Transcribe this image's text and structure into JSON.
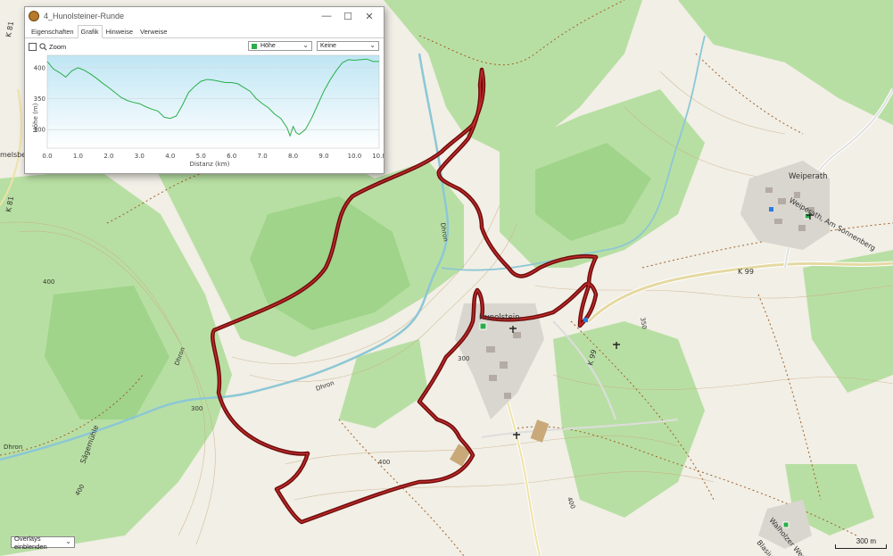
{
  "window": {
    "title": "4_Hunolsteiner-Runde",
    "minimize_glyph": "—",
    "maximize_glyph": "☐",
    "close_glyph": "✕",
    "tabs": [
      {
        "label": "Eigenschaften",
        "active": false
      },
      {
        "label": "Grafik",
        "active": true
      },
      {
        "label": "Hinweise",
        "active": false
      },
      {
        "label": "Verweise",
        "active": false
      }
    ],
    "zoom_label": "Zoom",
    "series_select": "Höhe",
    "series_color": "#2bae4a",
    "second_select": "Keine",
    "arrow": "⌄"
  },
  "chart_data": {
    "type": "area",
    "ylabel": "Höhe (m)",
    "xlabel": "Distanz  (km)",
    "xlim": [
      0,
      10.8
    ],
    "ylim": [
      270,
      420
    ],
    "xticks": [
      "0.0",
      "1.0",
      "2.0",
      "3.0",
      "4.0",
      "5.0",
      "6.0",
      "7.0",
      "8.0",
      "9.0",
      "10.0",
      "10.8"
    ],
    "yticks": [
      "400",
      "350",
      "300"
    ],
    "x": [
      0,
      0.2,
      0.4,
      0.6,
      0.8,
      1.0,
      1.2,
      1.4,
      1.6,
      1.8,
      2.0,
      2.2,
      2.4,
      2.6,
      2.8,
      3.0,
      3.2,
      3.4,
      3.6,
      3.8,
      4.0,
      4.2,
      4.4,
      4.6,
      4.8,
      5.0,
      5.2,
      5.4,
      5.6,
      5.8,
      6.0,
      6.2,
      6.4,
      6.6,
      6.8,
      7.0,
      7.2,
      7.4,
      7.6,
      7.8,
      7.9,
      8.0,
      8.1,
      8.2,
      8.4,
      8.6,
      8.8,
      9.0,
      9.2,
      9.4,
      9.6,
      9.8,
      10.0,
      10.2,
      10.4,
      10.6,
      10.8
    ],
    "y": [
      410,
      398,
      392,
      385,
      395,
      400,
      396,
      390,
      383,
      375,
      368,
      360,
      352,
      347,
      344,
      342,
      337,
      333,
      330,
      320,
      318,
      322,
      340,
      360,
      370,
      378,
      381,
      380,
      378,
      376,
      376,
      374,
      368,
      362,
      350,
      342,
      335,
      325,
      318,
      303,
      290,
      305,
      295,
      292,
      300,
      318,
      340,
      362,
      380,
      395,
      408,
      413,
      412,
      413,
      414,
      410,
      410
    ]
  },
  "map": {
    "labels": {
      "village1": "Hunolstein",
      "village2": "Weiperath",
      "street1": "Weiperath, Am Sonnenberg",
      "street2": "Walholzer Weg",
      "street3": "Blasius",
      "mill": "Sägemühle",
      "road1": "K 99",
      "road2": "K 99",
      "road3": "K 81",
      "road4": "K 81",
      "river1": "Dhron",
      "river2": "Dhron",
      "river3": "Dhron",
      "river4": "Dhron",
      "place_partial": "melsberg",
      "contour1": "400",
      "contour2": "300",
      "contour3": "300",
      "contour4": "350",
      "contour5": "400",
      "contour6": "400",
      "contour7": "400"
    }
  },
  "overlays_button": "Overlays einblenden",
  "scale_label": "300 m"
}
